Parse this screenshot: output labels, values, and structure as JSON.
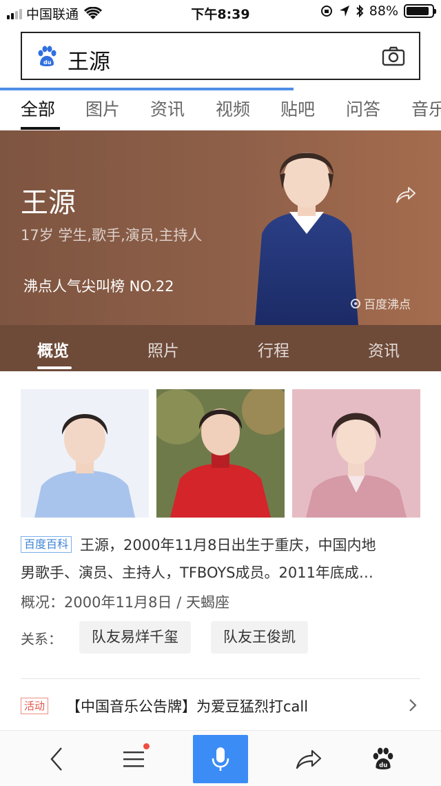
{
  "status_bar": {
    "carrier": "中国联通",
    "time": "下午8:39",
    "battery": "88%",
    "battery_level": 0.88
  },
  "search": {
    "query": "王源"
  },
  "tabs": [
    {
      "label": "全部",
      "active": true
    },
    {
      "label": "图片"
    },
    {
      "label": "资讯"
    },
    {
      "label": "视频"
    },
    {
      "label": "贴吧"
    },
    {
      "label": "问答"
    },
    {
      "label": "音乐"
    }
  ],
  "hero": {
    "name": "王源",
    "description": "17岁 学生,歌手,演员,主持人",
    "rank": "沸点人气尖叫榜 NO.22",
    "watermark": "百度沸点"
  },
  "subtabs": [
    {
      "label": "概览",
      "active": true
    },
    {
      "label": "照片"
    },
    {
      "label": "行程"
    },
    {
      "label": "资讯"
    }
  ],
  "info": {
    "baike_badge": "百度百科",
    "summary_line1": "王源，2000年11月8日出生于重庆，中国内地",
    "summary_line2": "男歌手、演员、主持人，TFBOYS成员。2011年底成…",
    "overview": "概况：2000年11月8日  /  天蝎座",
    "relation_label": "关系：",
    "relations": [
      "队友易烊千玺",
      "队友王俊凯"
    ]
  },
  "event": {
    "badge": "活动",
    "text": "【中国音乐公告牌】为爱豆猛烈打call"
  },
  "colors": {
    "accent_blue": "#3c8cf6",
    "hero_brown": "#8f6049",
    "subtab_brown": "#6e4a39"
  }
}
